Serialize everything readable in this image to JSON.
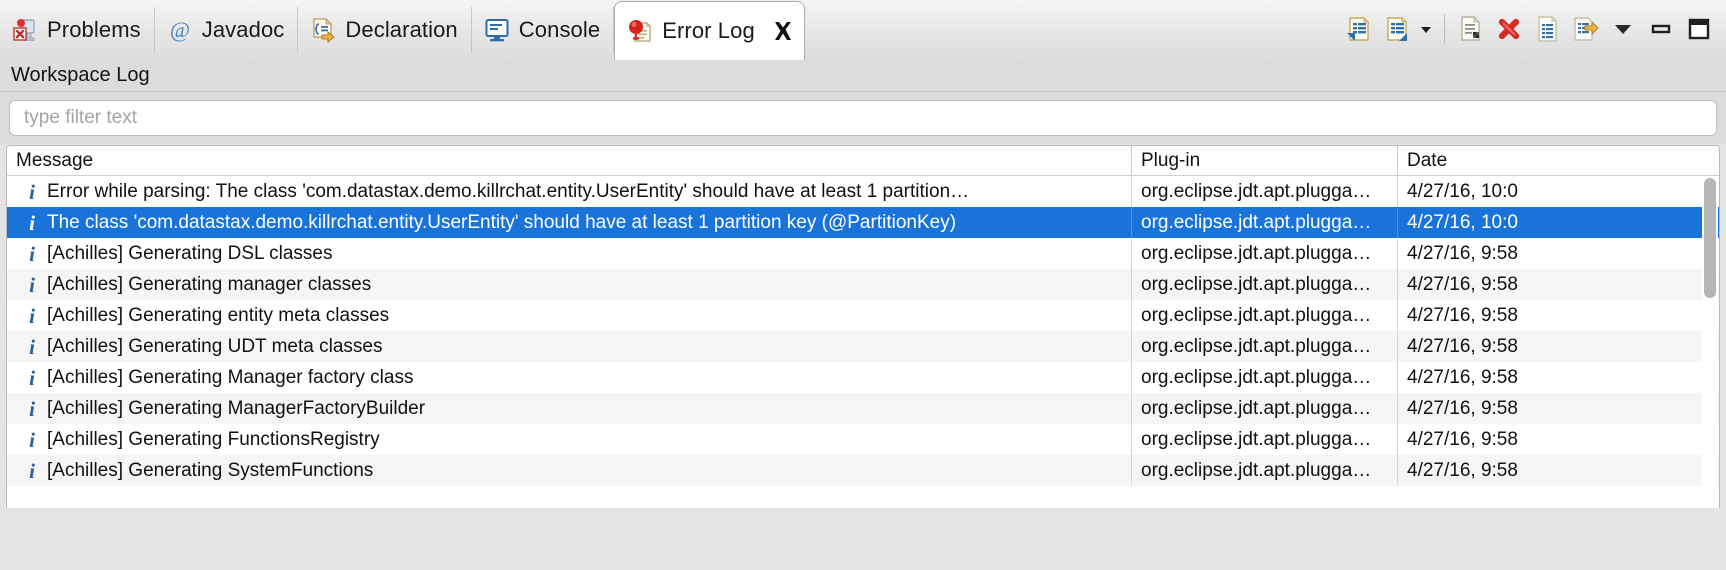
{
  "window": {
    "active_view": "Error Log"
  },
  "tabs": [
    {
      "label": "Problems",
      "icon": "problems-icon",
      "active": false
    },
    {
      "label": "Javadoc",
      "icon": "javadoc-at-icon",
      "active": false
    },
    {
      "label": "Declaration",
      "icon": "declaration-icon",
      "active": false
    },
    {
      "label": "Console",
      "icon": "console-icon",
      "active": false
    },
    {
      "label": "Error Log",
      "icon": "error-log-icon",
      "active": true,
      "close_icon": "close-icon"
    }
  ],
  "toolbar": {
    "buttons": [
      {
        "name": "export-log-button",
        "icon": "export-log-icon",
        "tooltip": "Export Log"
      },
      {
        "name": "import-log-button",
        "icon": "import-log-icon",
        "tooltip": "Import Log"
      },
      {
        "name": "import-log-menu-button",
        "icon": "chevron-down-icon",
        "tooltip": "Import Log Menu"
      },
      {
        "name": "clear-log-viewer-button",
        "icon": "clear-log-viewer-icon",
        "tooltip": "Clear Log Viewer"
      },
      {
        "name": "delete-log-button",
        "icon": "delete-log-icon",
        "tooltip": "Delete Log"
      },
      {
        "name": "open-log-button",
        "icon": "open-log-icon",
        "tooltip": "Open Log"
      },
      {
        "name": "restore-log-button",
        "icon": "restore-log-icon",
        "tooltip": "Restore Log"
      },
      {
        "name": "view-menu-button",
        "icon": "view-menu-icon",
        "tooltip": "View Menu"
      },
      {
        "name": "minimize-button",
        "icon": "minimize-icon",
        "tooltip": "Minimize"
      },
      {
        "name": "maximize-button",
        "icon": "maximize-icon",
        "tooltip": "Maximize"
      }
    ]
  },
  "form": {
    "title": "Workspace Log"
  },
  "filter": {
    "value": "",
    "placeholder": "type filter text"
  },
  "table": {
    "columns": [
      {
        "label": "Message",
        "name": "column-message"
      },
      {
        "label": "Plug-in",
        "name": "column-plugin"
      },
      {
        "label": "Date",
        "name": "column-date"
      }
    ],
    "rows": [
      {
        "severity": "info",
        "message": "Error while parsing: The class 'com.datastax.demo.killrchat.entity.UserEntity' should have at least 1 partition…",
        "plugin": "org.eclipse.jdt.apt.plugga…",
        "date": "4/27/16, 10:0",
        "selected": false
      },
      {
        "severity": "info",
        "message": "The class 'com.datastax.demo.killrchat.entity.UserEntity' should have at least 1 partition key (@PartitionKey)",
        "plugin": "org.eclipse.jdt.apt.plugga…",
        "date": "4/27/16, 10:0",
        "selected": true
      },
      {
        "severity": "info",
        "message": "[Achilles] Generating DSL classes",
        "plugin": "org.eclipse.jdt.apt.plugga…",
        "date": "4/27/16, 9:58",
        "selected": false
      },
      {
        "severity": "info",
        "message": "[Achilles] Generating manager classes",
        "plugin": "org.eclipse.jdt.apt.plugga…",
        "date": "4/27/16, 9:58",
        "selected": false
      },
      {
        "severity": "info",
        "message": "[Achilles] Generating entity meta classes",
        "plugin": "org.eclipse.jdt.apt.plugga…",
        "date": "4/27/16, 9:58",
        "selected": false
      },
      {
        "severity": "info",
        "message": "[Achilles] Generating UDT meta classes",
        "plugin": "org.eclipse.jdt.apt.plugga…",
        "date": "4/27/16, 9:58",
        "selected": false
      },
      {
        "severity": "info",
        "message": "[Achilles] Generating Manager factory class",
        "plugin": "org.eclipse.jdt.apt.plugga…",
        "date": "4/27/16, 9:58",
        "selected": false
      },
      {
        "severity": "info",
        "message": "[Achilles] Generating ManagerFactoryBuilder",
        "plugin": "org.eclipse.jdt.apt.plugga…",
        "date": "4/27/16, 9:58",
        "selected": false
      },
      {
        "severity": "info",
        "message": "[Achilles] Generating FunctionsRegistry",
        "plugin": "org.eclipse.jdt.apt.plugga…",
        "date": "4/27/16, 9:58",
        "selected": false
      },
      {
        "severity": "info",
        "message": "[Achilles] Generating SystemFunctions",
        "plugin": "org.eclipse.jdt.apt.plugga…",
        "date": "4/27/16, 9:58",
        "selected": false
      }
    ]
  },
  "colors": {
    "selection": "#1a73d9",
    "info_icon": "#2a6099",
    "error_red": "#d42b24",
    "row_alt": "#f5f5f5",
    "panel_bg": "#dcdcdc"
  }
}
